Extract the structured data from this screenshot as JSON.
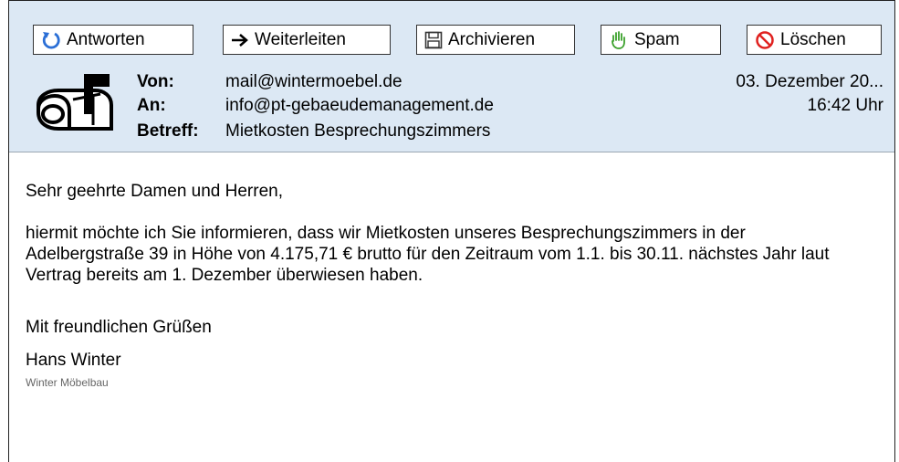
{
  "toolbar": {
    "reply_label": "Antworten",
    "forward_label": "Weiterleiten",
    "archive_label": "Archivieren",
    "spam_label": "Spam",
    "delete_label": "Löschen"
  },
  "header": {
    "from_label": "Von:",
    "from_value": "mail@wintermoebel.de",
    "to_label": "An:",
    "to_value": "info@pt-gebaeudemanagement.de",
    "subject_label": "Betreff:",
    "subject_value": "Mietkosten Besprechungszimmers",
    "date": "03. Dezember 20...",
    "time": "16:42 Uhr"
  },
  "message": {
    "greeting": "Sehr geehrte Damen und Herren,",
    "paragraph": "hiermit möchte ich Sie informieren, dass wir Mietkosten unseres Besprechungszimmers in der Adelbergstraße 39 in Höhe von 4.175,71 € brutto für den Zeitraum vom 1.1. bis 30.11. nächstes Jahr laut Vertrag bereits am 1. Dezember überwiesen haben.",
    "closing": "Mit freundlichen Grüßen",
    "sender_name": "Hans Winter",
    "sender_company": "Winter Möbelbau"
  },
  "colors": {
    "header_bg": "#dce8f4",
    "reply_icon": "#2b6fd6",
    "spam_icon": "#3aa02a",
    "delete_icon": "#e0211f"
  },
  "icons": [
    "reply-icon",
    "forward-arrow-icon",
    "save-disk-icon",
    "hand-icon",
    "no-entry-icon",
    "mailbox-icon"
  ]
}
